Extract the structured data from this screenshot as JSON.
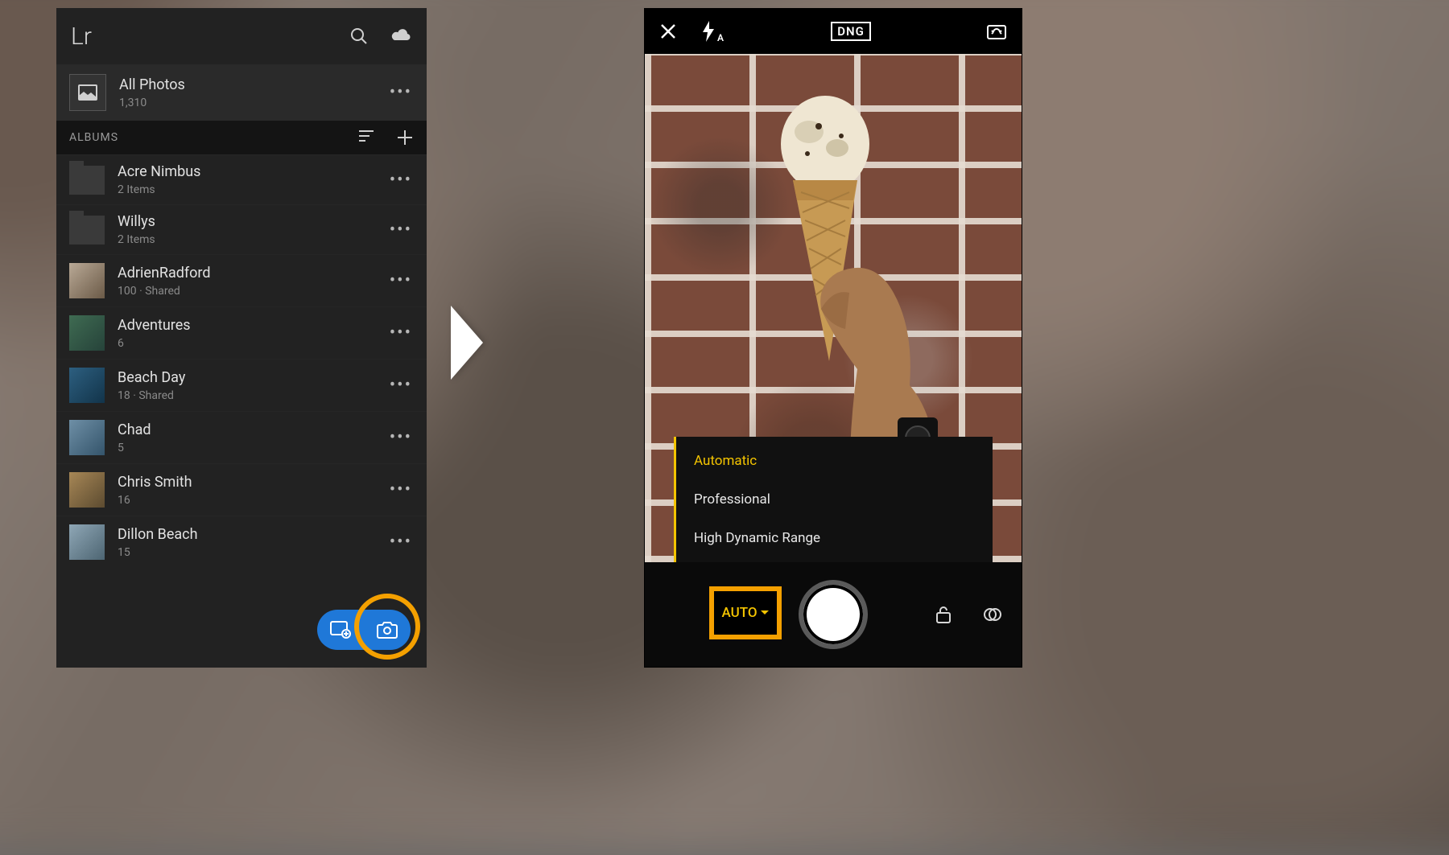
{
  "leftPanel": {
    "logo": "Lr",
    "allPhotos": {
      "title": "All Photos",
      "count": "1,310"
    },
    "albumsHeader": "ALBUMS",
    "albums": [
      {
        "kind": "folder",
        "name": "Acre Nimbus",
        "meta": "2 Items"
      },
      {
        "kind": "folder",
        "name": "Willys",
        "meta": "2 Items"
      },
      {
        "kind": "album",
        "name": "AdrienRadford",
        "meta": "100 · Shared",
        "thumb": "linear-gradient(135deg,#b9a996,#6b5a47)"
      },
      {
        "kind": "album",
        "name": "Adventures",
        "meta": "6",
        "thumb": "linear-gradient(135deg,#3f6b52,#26433a)"
      },
      {
        "kind": "album",
        "name": "Beach Day",
        "meta": "18 · Shared",
        "thumb": "linear-gradient(135deg,#2d5f80,#12344a)"
      },
      {
        "kind": "album",
        "name": "Chad",
        "meta": "5",
        "thumb": "linear-gradient(135deg,#6e8fa6,#34546b)"
      },
      {
        "kind": "album",
        "name": "Chris Smith",
        "meta": "16",
        "thumb": "linear-gradient(135deg,#a78756,#5c4b30)"
      },
      {
        "kind": "album",
        "name": "Dillon Beach",
        "meta": "15",
        "thumb": "linear-gradient(135deg,#8fa7b6,#4d6572)"
      }
    ]
  },
  "rightPanel": {
    "format": "DNG",
    "flash": "A",
    "modes": [
      "Automatic",
      "Professional",
      "High Dynamic Range"
    ],
    "selectedMode": "Automatic",
    "autoLabel": "AUTO"
  },
  "colors": {
    "accent": "#f4a000",
    "yellow": "#f4c400",
    "blue": "#1f78d8"
  }
}
